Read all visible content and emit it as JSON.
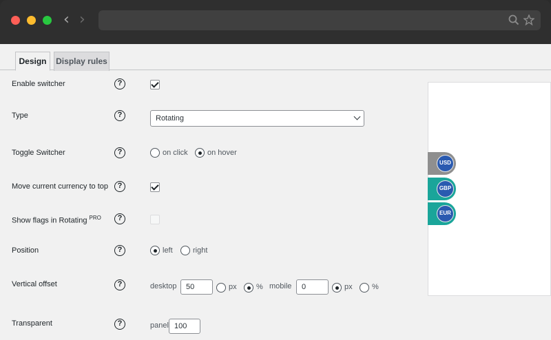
{
  "tabs": [
    {
      "label": "Design",
      "active": true
    },
    {
      "label": "Display rules",
      "active": false
    }
  ],
  "rows": {
    "enable_switcher": {
      "label": "Enable switcher",
      "checked": true
    },
    "type": {
      "label": "Type",
      "selected": "Rotating"
    },
    "toggle_switcher": {
      "label": "Toggle Switcher",
      "options": [
        "on click",
        "on hover"
      ],
      "selected": "on hover"
    },
    "move_current": {
      "label": "Move current currency to top",
      "checked": true
    },
    "show_flags": {
      "label": "Show flags in Rotating",
      "badge": "PRO",
      "checked": false,
      "disabled": true
    },
    "position": {
      "label": "Position",
      "options": [
        "left",
        "right"
      ],
      "selected": "left"
    },
    "vertical_offset": {
      "label": "Vertical offset",
      "desktop_label": "desktop",
      "desktop_value": "50",
      "mobile_label": "mobile",
      "mobile_value": "0",
      "unit_px": "px",
      "unit_pct": "%",
      "desktop_unit": "%",
      "mobile_unit": "px"
    },
    "transparent": {
      "label": "Transparent",
      "panel_label": "panel",
      "panel_value": "100"
    }
  },
  "preview": {
    "currencies": [
      {
        "code": "USD",
        "color": "#8f8f8f"
      },
      {
        "code": "GBP",
        "color": "#1aa59a"
      },
      {
        "code": "EUR",
        "color": "#1aa59a"
      }
    ]
  },
  "help_glyph": "?",
  "icons": [
    "search-icon",
    "star-icon",
    "chevron-left-icon",
    "chevron-right-icon",
    "help-icon"
  ]
}
